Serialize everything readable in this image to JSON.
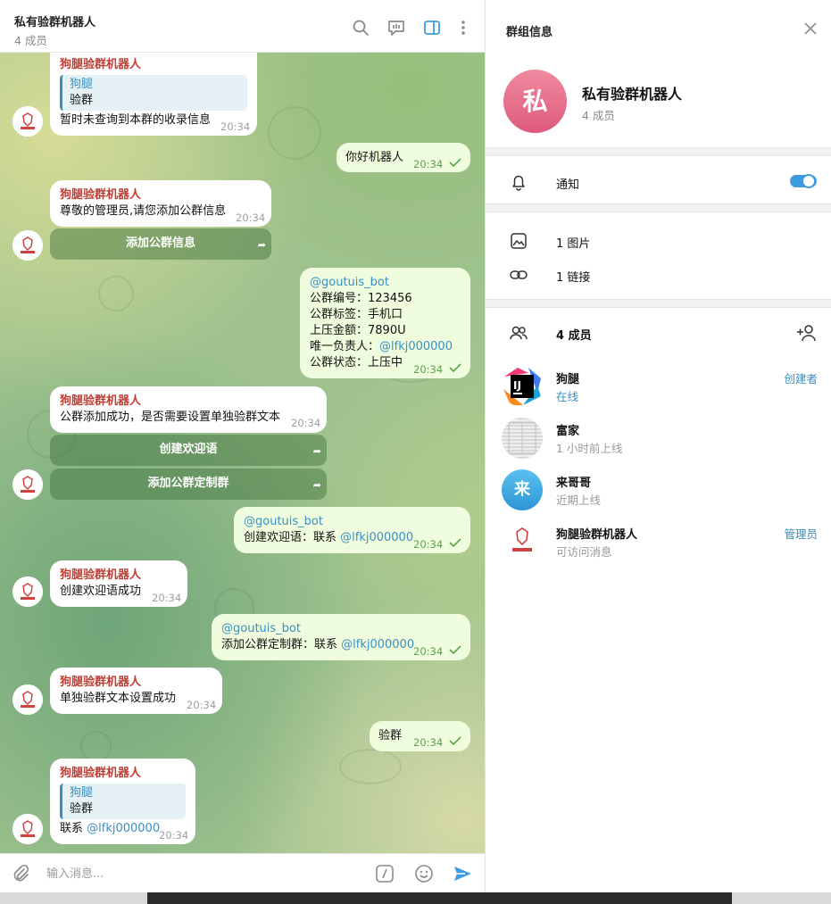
{
  "chat": {
    "title": "私有验群机器人",
    "subtitle": "4 成员",
    "header_icons": [
      "search-icon",
      "live-chat-icon",
      "sidebar-toggle-icon",
      "more-vertical-icon"
    ],
    "messages": [
      {
        "sender": "狗腿验群机器人",
        "reply_name": "狗腿",
        "reply_text": "验群",
        "text": "暂时未查询到本群的收录信息",
        "time": "20:34"
      },
      {
        "text": "你好机器人",
        "time": "20:34"
      },
      {
        "sender": "狗腿验群机器人",
        "text": "尊敬的管理员,请您添加公群信息",
        "time": "20:34",
        "button": "添加公群信息"
      },
      {
        "mention": "@goutuis_bot",
        "lines": [
          "公群编号：123456",
          "公群标签：手机口",
          "上压金额：7890U",
          "唯一负责人："
        ],
        "line4_mention": "@lfkj000000",
        "last_line": "公群状态：上压中",
        "time": "20:34"
      },
      {
        "sender": "狗腿验群机器人",
        "text": "公群添加成功，是否需要设置单独验群文本",
        "time": "20:34",
        "buttons": [
          "创建欢迎语",
          "添加公群定制群"
        ]
      },
      {
        "mention": "@goutuis_bot",
        "text": "创建欢迎语：联系 ",
        "text_mention": "@lfkj000000",
        "time": "20:34"
      },
      {
        "sender": "狗腿验群机器人",
        "text": "创建欢迎语成功",
        "time": "20:34"
      },
      {
        "mention": "@goutuis_bot",
        "text": "添加公群定制群：联系 ",
        "text_mention": "@lfkj000000",
        "time": "20:34"
      },
      {
        "sender": "狗腿验群机器人",
        "text": "单独验群文本设置成功",
        "time": "20:34"
      },
      {
        "text": "验群",
        "time": "20:34"
      },
      {
        "sender": "狗腿验群机器人",
        "reply_name": "狗腿",
        "reply_text": "验群",
        "text": "联系 ",
        "text_mention": "@lfkj000000",
        "time": "20:34"
      }
    ],
    "composer": {
      "placeholder": "输入消息...",
      "icons": [
        "attach-icon",
        "command-icon",
        "emoji-icon",
        "send-icon"
      ]
    }
  },
  "info": {
    "header": "群组信息",
    "group_name": "私有验群机器人",
    "group_avatar_letter": "私",
    "group_sub": "4 成员",
    "notifications_label": "通知",
    "notifications_on": true,
    "media": [
      {
        "icon": "image-icon",
        "label": "1 图片"
      },
      {
        "icon": "link-icon",
        "label": "1 链接"
      }
    ],
    "members_title": "4 成员",
    "members": [
      {
        "name": "狗腿",
        "status": "在线",
        "role": "创建者",
        "avatar": "ij-logo"
      },
      {
        "name": "富家",
        "status": "1 小时前上线",
        "role": "",
        "avatar": "photo"
      },
      {
        "name": "来哥哥",
        "status": "近期上线",
        "role": "",
        "avatar_letter": "来"
      },
      {
        "name": "狗腿验群机器人",
        "status": "可访问消息",
        "role": "管理员",
        "avatar": "bot-logo"
      }
    ]
  },
  "colors": {
    "accent": "#3a8fc1",
    "sender_red": "#c03d33",
    "outgoing_bubble": "#effdde",
    "toggle": "#3d9be0"
  }
}
